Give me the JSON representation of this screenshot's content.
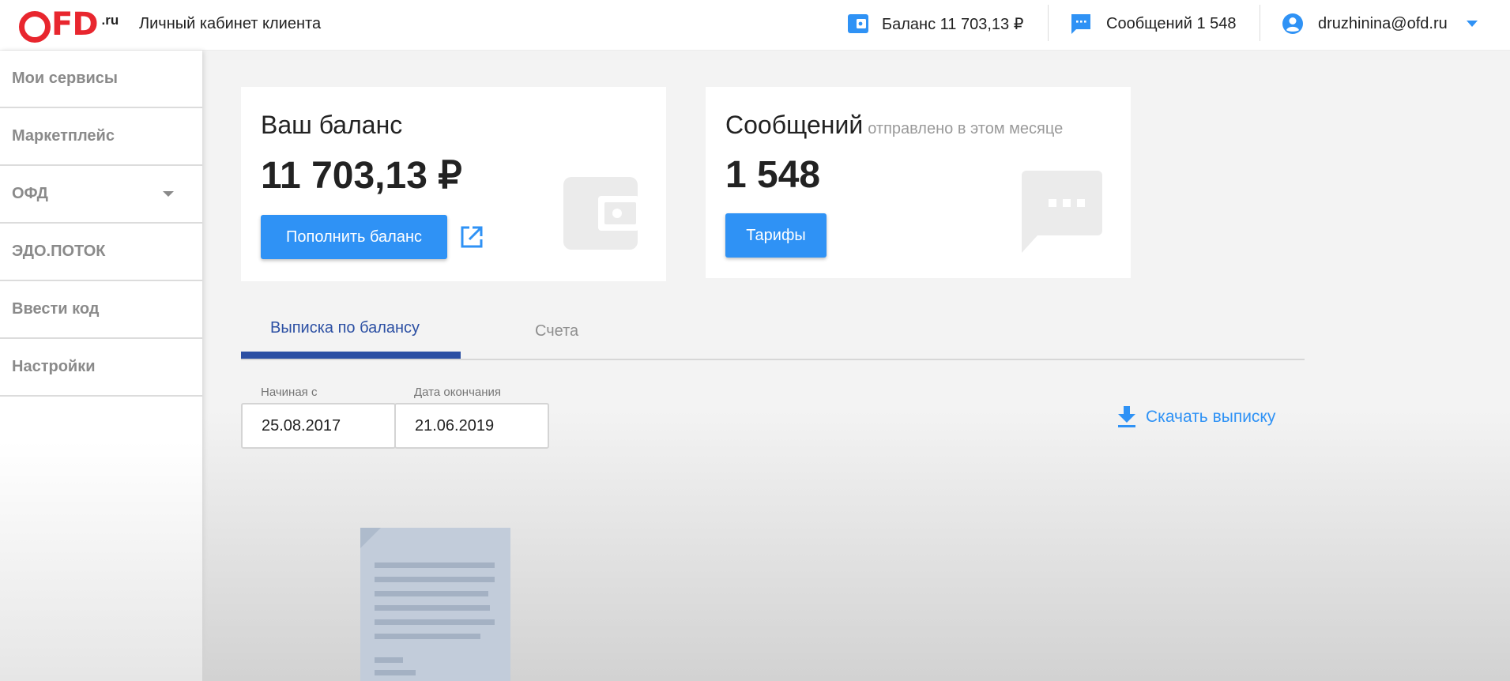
{
  "header": {
    "logo_text": "FD",
    "logo_suffix": ".ru",
    "subtitle": "Личный кабинет клиента",
    "balance_label": "Баланс 11 703,13 ₽",
    "messages_label": "Сообщений 1 548",
    "user_email": "druzhinina@ofd.ru"
  },
  "sidebar": {
    "items": [
      {
        "label": "Мои сервисы"
      },
      {
        "label": "Маркетплейс"
      },
      {
        "label": "ОФД"
      },
      {
        "label": "ЭДО.ПОТОК"
      },
      {
        "label": "Ввести код"
      },
      {
        "label": "Настройки"
      }
    ]
  },
  "balance_card": {
    "title": "Ваш баланс",
    "value": "11 703,13 ₽",
    "button_label": "Пополнить баланс"
  },
  "messages_card": {
    "title": "Сообщений",
    "subtitle": "отправлено в этом месяце",
    "value": "1 548",
    "button_label": "Тарифы"
  },
  "tabs": [
    {
      "label": "Выписка по балансу",
      "active": true
    },
    {
      "label": "Счета",
      "active": false
    }
  ],
  "filters": {
    "start_label": "Начиная с",
    "start_value": "25.08.2017",
    "end_label": "Дата окончания",
    "end_value": "21.06.2019"
  },
  "download_label": "Скачать выписку",
  "colors": {
    "brand_red": "#e8262e",
    "accent_blue": "#2f92f5",
    "tab_active": "#2b4fa3"
  },
  "icons": [
    "wallet-icon",
    "chat-icon",
    "account-icon",
    "chevron-down-icon",
    "external-link-icon",
    "download-icon",
    "document-icon"
  ]
}
